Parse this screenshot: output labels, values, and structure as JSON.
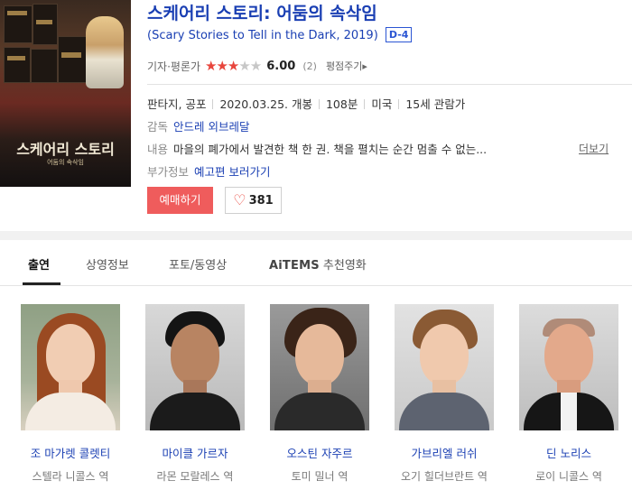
{
  "movie": {
    "title": "스케어리 스토리: 어둠의 속삭임",
    "original_title": "(Scary Stories to Tell in the Dark, 2019)",
    "dday_badge": "D-4",
    "poster": {
      "title": "스케어리 스토리",
      "subtitle": "어둠의 속삭임"
    },
    "rating": {
      "label": "기자·평론가",
      "stars": "★★★",
      "stars_off": "★★",
      "score": "6.00",
      "count": "(2)",
      "rate_link": "평점주기▸"
    },
    "genre": "판타지, 공포",
    "release": "2020.03.25. 개봉",
    "runtime": "108분",
    "country": "미국",
    "age": "15세 관람가",
    "director_label": "감독",
    "director": "안드레 외브레달",
    "summary_label": "내용",
    "summary": "마을의 폐가에서 발견한 책 한 권. 책을 펼치는 순간 멈출 수 없는...",
    "more_link": "더보기",
    "extra_label": "부가정보",
    "extra_link": "예고편 보러가기",
    "reserve_button": "예매하기",
    "like_count": "381"
  },
  "tabs": [
    {
      "label": "출연",
      "active": true
    },
    {
      "label": "상영정보"
    },
    {
      "label": "포토/동영상"
    },
    {
      "label_brand": "AiTEMS",
      "label": "추천영화"
    }
  ],
  "cast": [
    {
      "name": "조 마가렛 콜렛티",
      "role": "스텔라 니콜스 역",
      "icon": "person-photo"
    },
    {
      "name": "마이클 가르자",
      "role": "라몬 모랄레스 역",
      "icon": "person-photo"
    },
    {
      "name": "오스틴 자주르",
      "role": "토미 밀너 역",
      "icon": "person-photo"
    },
    {
      "name": "가브리엘 러쉬",
      "role": "오기 힐더브란트 역",
      "icon": "person-photo"
    },
    {
      "name": "딘 노리스",
      "role": "로이 니콜스 역",
      "icon": "person-photo"
    }
  ],
  "colors": {
    "link": "#1a3fb3",
    "accent": "#ef5c5c",
    "star": "#e8453c"
  }
}
